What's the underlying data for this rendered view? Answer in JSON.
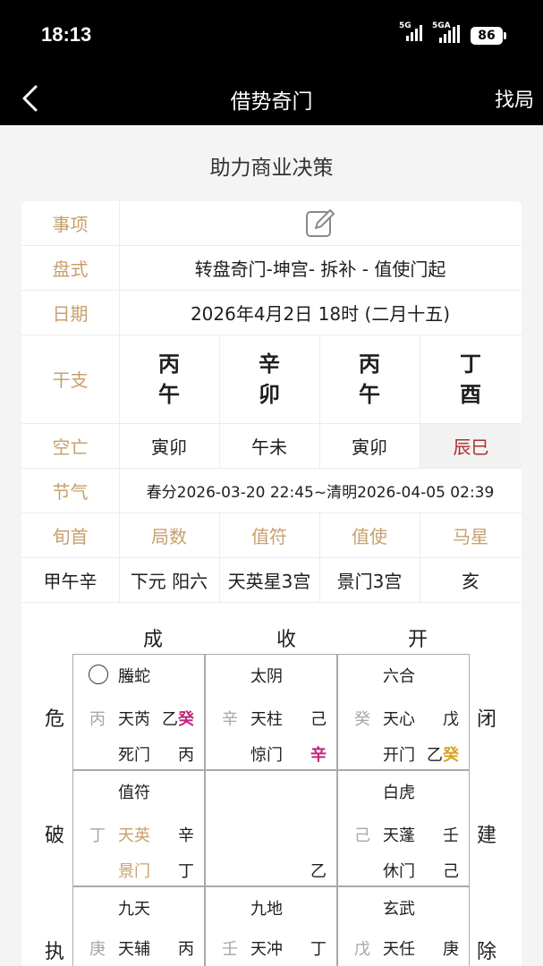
{
  "status": {
    "time": "18:13",
    "sig1": "5G",
    "sig2": "5GA",
    "battery": "86"
  },
  "nav": {
    "title": "借势奇门",
    "right_label": "找局"
  },
  "subtitle": "助力商业决策",
  "info": {
    "shixiang_label": "事项",
    "panshi_label": "盘式",
    "panshi_value": "转盘奇门-坤宫- 拆补 - 值使门起",
    "riqi_label": "日期",
    "riqi_value": "2026年4月2日 18时 (二月十五)",
    "ganzhi_label": "干支",
    "ganzhi": [
      {
        "gan": "丙",
        "zhi": "午"
      },
      {
        "gan": "辛",
        "zhi": "卯"
      },
      {
        "gan": "丙",
        "zhi": "午"
      },
      {
        "gan": "丁",
        "zhi": "酉"
      }
    ],
    "kongwang_label": "空亡",
    "kongwang": [
      "寅卯",
      "午未",
      "寅卯",
      "辰巳"
    ],
    "jieqi_label": "节气",
    "jieqi_value": "春分2026-03-20 22:45~清明2026-04-05 02:39",
    "headers": [
      "旬首",
      "局数",
      "值符",
      "值使",
      "马星"
    ],
    "values": [
      "甲午辛",
      "下元 阳六",
      "天英星3宫",
      "景门3宫",
      "亥"
    ]
  },
  "grid": {
    "top_labels": [
      "成",
      "收",
      "开"
    ],
    "left_labels": [
      "危",
      "破",
      "执"
    ],
    "right_labels": [
      "闭",
      "建",
      "除"
    ],
    "palaces": [
      {
        "god": "螣蛇",
        "gan_left": "丙",
        "star": "天芮",
        "gan_r1": "乙",
        "gan_r1b": "癸",
        "door": "死门",
        "gan_r2": "丙"
      },
      {
        "god": "太阴",
        "gan_left": "辛",
        "star": "天柱",
        "gan_r1": "己",
        "door": "惊门",
        "gan_r2": "辛"
      },
      {
        "god": "六合",
        "gan_left": "癸",
        "star": "天心",
        "gan_r1": "戊",
        "door": "开门",
        "gan_r2": "乙",
        "gan_r2b": "癸"
      },
      {
        "god": "值符",
        "gan_left": "丁",
        "star": "天英",
        "gan_r1": "辛",
        "door": "景门",
        "gan_r2": "丁"
      },
      {
        "center": "乙"
      },
      {
        "god": "白虎",
        "gan_left": "己",
        "star": "天蓬",
        "gan_r1": "壬",
        "door": "休门",
        "gan_r2": "己"
      },
      {
        "god": "九天",
        "gan_left": "庚",
        "star": "天辅",
        "gan_r1": "丙"
      },
      {
        "god": "九地",
        "gan_left": "壬",
        "star": "天冲",
        "gan_r1": "丁"
      },
      {
        "god": "玄武",
        "gan_left": "戊",
        "star": "天任",
        "gan_r1": "庚"
      }
    ]
  },
  "colors": {
    "label_gold": "#c8a06c",
    "kong_red": "#b22d2d",
    "magenta": "#c0277a",
    "yellow": "#d9a41a"
  }
}
